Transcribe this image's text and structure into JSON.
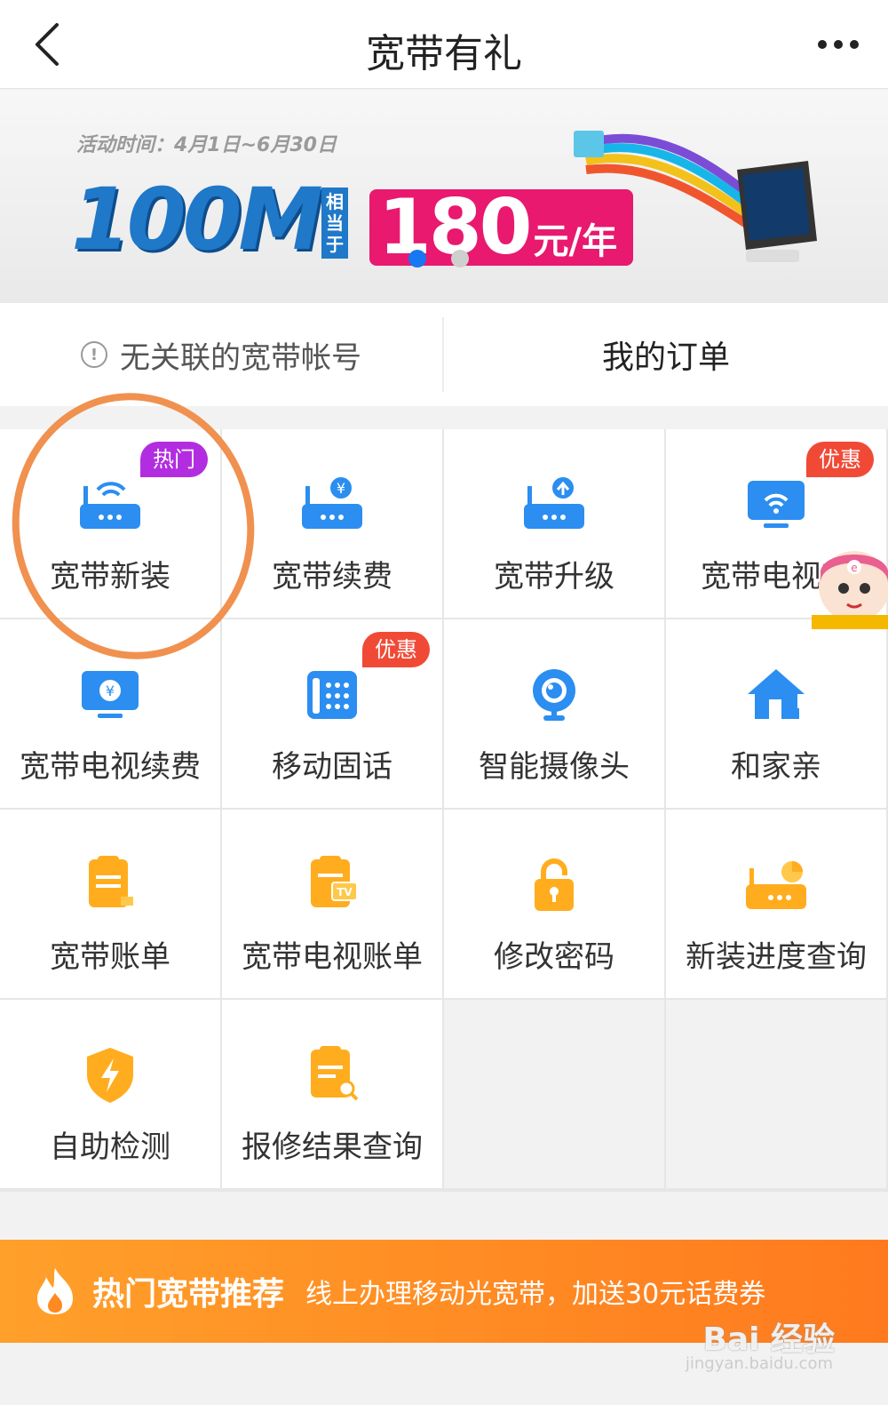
{
  "header": {
    "title": "宽带有礼"
  },
  "banner": {
    "activity_time": "活动时间：4月1日~6月30日",
    "speed": "100M",
    "equivalent": "相当于",
    "price": "180",
    "price_unit": "元/年"
  },
  "account": {
    "unlinked_text": "无关联的宽带帐号",
    "orders_label": "我的订单"
  },
  "grid": [
    {
      "label": "宽带新装",
      "badge": "热门",
      "icon": "router-wifi-icon"
    },
    {
      "label": "宽带续费",
      "badge": "",
      "icon": "router-yuan-icon"
    },
    {
      "label": "宽带升级",
      "badge": "",
      "icon": "router-upgrade-icon"
    },
    {
      "label": "宽带电视新",
      "badge": "优惠",
      "icon": "tv-wifi-icon"
    },
    {
      "label": "宽带电视续费",
      "badge": "",
      "icon": "tv-yuan-icon"
    },
    {
      "label": "移动固话",
      "badge": "优惠",
      "icon": "landline-phone-icon"
    },
    {
      "label": "智能摄像头",
      "badge": "",
      "icon": "camera-icon"
    },
    {
      "label": "和家亲",
      "badge": "",
      "icon": "home-icon"
    },
    {
      "label": "宽带账单",
      "badge": "",
      "icon": "bill-icon"
    },
    {
      "label": "宽带电视账单",
      "badge": "",
      "icon": "tv-bill-icon"
    },
    {
      "label": "修改密码",
      "badge": "",
      "icon": "lock-icon"
    },
    {
      "label": "新装进度查询",
      "badge": "",
      "icon": "router-progress-icon"
    },
    {
      "label": "自助检测",
      "badge": "",
      "icon": "shield-bolt-icon"
    },
    {
      "label": "报修结果查询",
      "badge": "",
      "icon": "repair-search-icon"
    }
  ],
  "promo": {
    "title": "热门宽带推荐",
    "text": "线上办理移动光宽带，加送30元话费券"
  },
  "watermark": {
    "main": "Bai 经验",
    "sub": "jingyan.baidu.com"
  },
  "colors": {
    "accent_blue": "#1f78c8",
    "icon_blue": "#2b8ef0",
    "icon_orange": "#ffad1f",
    "hot_badge": "#b32de0",
    "deal_badge": "#f04a36",
    "promo": "#ff8a22"
  }
}
